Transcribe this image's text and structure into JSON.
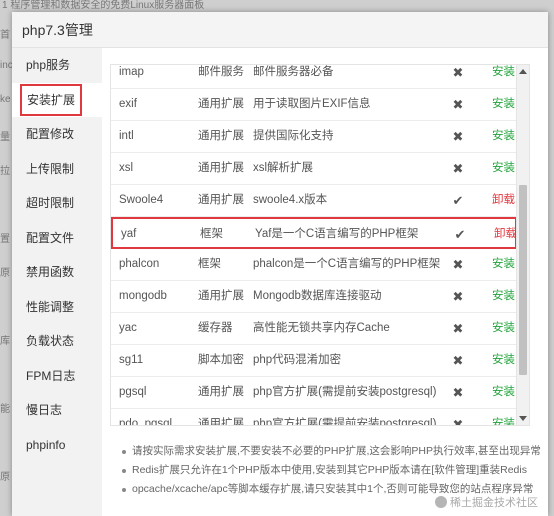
{
  "background": {
    "top_text": "1 程序管理和数据安全的免费Linux服务器面板",
    "left_fragments": [
      "首",
      "inc",
      "ke",
      "量",
      "拉",
      "",
      "置",
      "原",
      "",
      "库",
      "",
      "能",
      "",
      "原"
    ]
  },
  "dialog": {
    "title": "php7.3管理"
  },
  "sidebar": {
    "items": [
      {
        "label": "php服务"
      },
      {
        "label": "安装扩展"
      },
      {
        "label": "配置修改"
      },
      {
        "label": "上传限制"
      },
      {
        "label": "超时限制"
      },
      {
        "label": "配置文件"
      },
      {
        "label": "禁用函数"
      },
      {
        "label": "性能调整"
      },
      {
        "label": "负载状态"
      },
      {
        "label": "FPM日志"
      },
      {
        "label": "慢日志"
      },
      {
        "label": "phpinfo"
      }
    ]
  },
  "extensions": [
    {
      "name": "imap",
      "type": "邮件服务",
      "desc": "邮件服务器必备",
      "status": "✖",
      "action": "安装"
    },
    {
      "name": "exif",
      "type": "通用扩展",
      "desc": "用于读取图片EXIF信息",
      "status": "✖",
      "action": "安装"
    },
    {
      "name": "intl",
      "type": "通用扩展",
      "desc": "提供国际化支持",
      "status": "✖",
      "action": "安装"
    },
    {
      "name": "xsl",
      "type": "通用扩展",
      "desc": "xsl解析扩展",
      "status": "✖",
      "action": "安装"
    },
    {
      "name": "Swoole4",
      "type": "通用扩展",
      "desc": "swoole4.x版本",
      "status": "✔",
      "action": "卸载"
    },
    {
      "name": "yaf",
      "type": "框架",
      "desc": "Yaf是一个C语言编写的PHP框架",
      "status": "✔",
      "action": "卸载"
    },
    {
      "name": "phalcon",
      "type": "框架",
      "desc": "phalcon是一个C语言编写的PHP框架",
      "status": "✖",
      "action": "安装"
    },
    {
      "name": "mongodb",
      "type": "通用扩展",
      "desc": "Mongodb数据库连接驱动",
      "status": "✖",
      "action": "安装"
    },
    {
      "name": "yac",
      "type": "缓存器",
      "desc": "高性能无锁共享内存Cache",
      "status": "✖",
      "action": "安装"
    },
    {
      "name": "sg11",
      "type": "脚本加密",
      "desc": "php代码混淆加密",
      "status": "✖",
      "action": "安装"
    },
    {
      "name": "pgsql",
      "type": "通用扩展",
      "desc": "php官方扩展(需提前安装postgresql)",
      "status": "✖",
      "action": "安装"
    },
    {
      "name": "pdo_pgsql",
      "type": "通用扩展",
      "desc": "php官方扩展(需提前安装postgresql)",
      "status": "✖",
      "action": "安装"
    }
  ],
  "notes": [
    "请按实际需求安装扩展,不要安装不必要的PHP扩展,这会影响PHP执行效率,甚至出现异常",
    "Redis扩展只允许在1个PHP版本中使用,安装到其它PHP版本请在[软件管理]重装Redis",
    "opcache/xcache/apc等脚本缓存扩展,请只安装其中1个,否则可能导致您的站点程序异常"
  ],
  "watermark": "稀土掘金技术社区",
  "colors": {
    "install": "#20a53a",
    "uninstall": "#e0383e",
    "highlight": "#e0383e"
  }
}
